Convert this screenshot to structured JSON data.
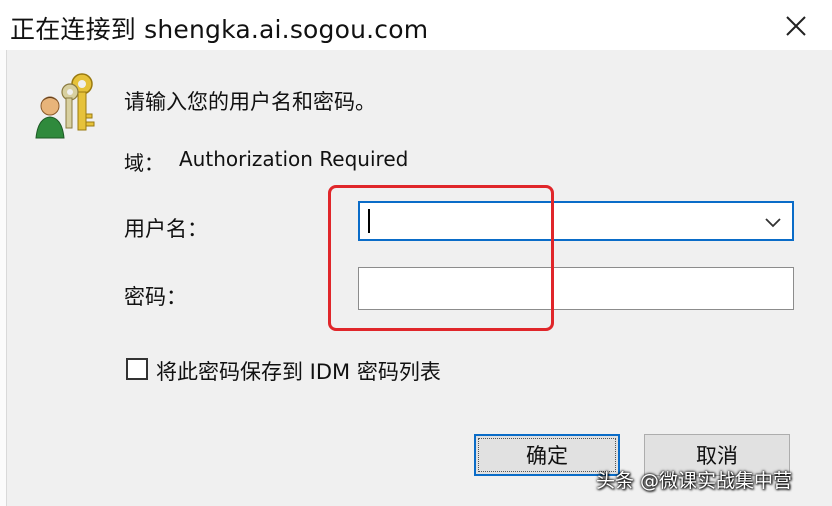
{
  "window": {
    "title": "正在连接到 shengka.ai.sogou.com"
  },
  "dialog": {
    "prompt": "请输入您的用户名和密码。",
    "realm_label": "域：",
    "realm_value": "Authorization Required",
    "username_label": "用户名：",
    "username_value": "",
    "password_label": "密码：",
    "password_value": "",
    "save_checkbox_label": "将此密码保存到 IDM 密码列表",
    "save_checked": false,
    "ok_label": "确定",
    "cancel_label": "取消"
  },
  "watermark": {
    "text": "头条 @微课实战集中营"
  },
  "colors": {
    "highlight": "#e0262a",
    "focus": "#0a6cc8"
  }
}
